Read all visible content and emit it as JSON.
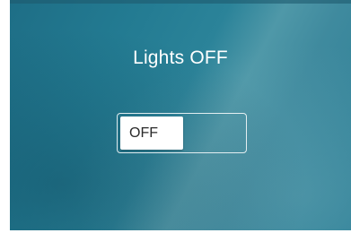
{
  "light_control": {
    "title": "Lights OFF",
    "toggle_label": "OFF",
    "toggle_state": "off"
  }
}
